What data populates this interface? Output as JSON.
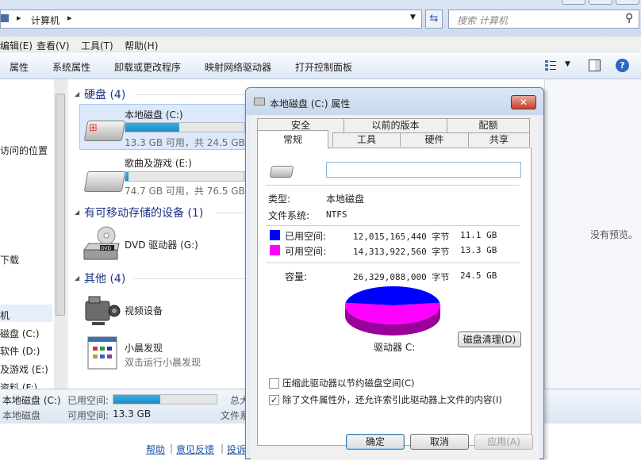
{
  "address": {
    "path": "计算机",
    "search_placeholder": "搜索 计算机"
  },
  "menu": [
    "编辑(E)",
    "查看(V)",
    "工具(T)",
    "帮助(H)"
  ],
  "toolbar": [
    "属性",
    "系统属性",
    "卸载或更改程序",
    "映射网络驱动器",
    "打开控制面板"
  ],
  "nav": {
    "items": [
      "",
      "",
      "访问的位置",
      "",
      "",
      "",
      "下载",
      "",
      "机",
      "磁盘 (C:)",
      "软件 (D:)",
      "及游戏 (E:)",
      "资料 (F:)"
    ]
  },
  "groups": {
    "hdd": {
      "title": "硬盘 (4)"
    },
    "removable": {
      "title": "有可移动存储的设备 (1)"
    },
    "other": {
      "title": "其他 (4)"
    }
  },
  "drives": [
    {
      "name": "本地磁盘 (C:)",
      "sub": "13.3 GB 可用，共 24.5 GB",
      "used_fraction": 0.456
    },
    {
      "name": "歌曲及游戏 (E:)",
      "sub": "74.7 GB 可用，共 76.5 GB",
      "used_fraction": 0.024
    }
  ],
  "removable": {
    "name": "DVD 驱动器 (G:)",
    "icon": "dvd-drive-icon"
  },
  "other": [
    {
      "name": "视频设备",
      "sub": "",
      "icon": "camcorder-icon"
    },
    {
      "name": "小晨发现",
      "sub": "双击运行小晨发现",
      "icon": "app-window-icon"
    }
  ],
  "preview": {
    "text": "没有预览。"
  },
  "status": {
    "drive": "本地磁盘 (C:)",
    "type": "本地磁盘",
    "used_label": "已用空间:",
    "free_label": "可用空间:",
    "free_value": "13.3 GB",
    "total_label": "总大",
    "fs_label": "文件系",
    "used_fraction": 0.456
  },
  "bottom_links": [
    "帮助",
    "意见反馈",
    "投诉"
  ],
  "dialog": {
    "title": "本地磁盘 (C:) 属性",
    "tabs_back": [
      "安全",
      "以前的版本",
      "配额"
    ],
    "tabs_front": [
      "常规",
      "工具",
      "硬件",
      "共享"
    ],
    "name_value": "",
    "type_label": "类型:",
    "type_value": "本地磁盘",
    "fs_label": "文件系统:",
    "fs_value": "NTFS",
    "used_label": "已用空间:",
    "used_bytes": "12,015,165,440 字节",
    "used_gb": "11.1 GB",
    "free_label": "可用空间:",
    "free_bytes": "14,313,922,560 字节",
    "free_gb": "13.3 GB",
    "capacity_label": "容量:",
    "capacity_bytes": "26,329,088,000 字节",
    "capacity_gb": "24.5 GB",
    "drive_label": "驱动器 C:",
    "cleanup_button": "磁盘清理(D)",
    "compress_label": "压缩此驱动器以节约磁盘空间(C)",
    "compress_checked": false,
    "index_label": "除了文件属性外，还允许索引此驱动器上文件的内容(I)",
    "index_checked": true,
    "ok": "确定",
    "cancel": "取消",
    "apply": "应用(A)",
    "colors": {
      "used": "#0000ff",
      "free": "#ff00ff"
    },
    "used_share": 0.4563
  }
}
